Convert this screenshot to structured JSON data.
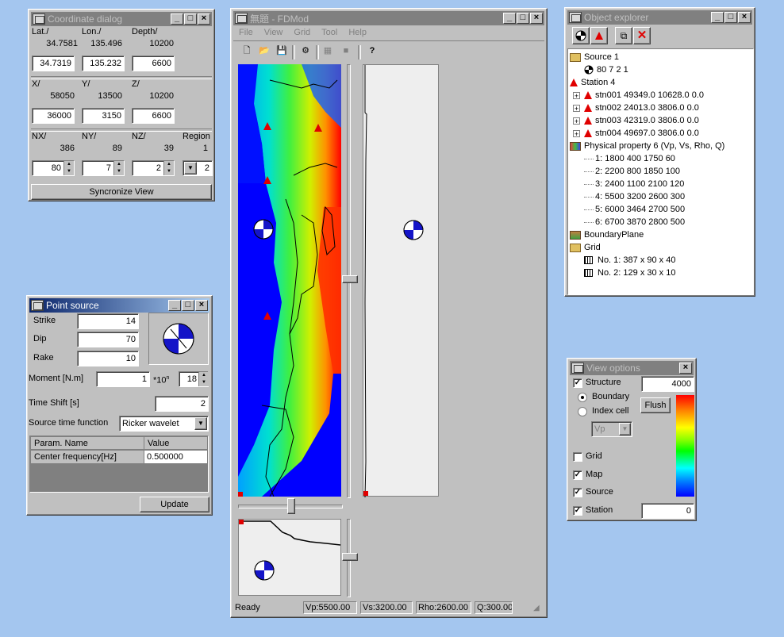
{
  "coord": {
    "title": "Coordinate dialog",
    "lat_label": "Lat./",
    "lon_label": "Lon./",
    "depth_label": "Depth/",
    "lat_value": "34.7581",
    "lon_value": "135.496",
    "depth_value": "10200",
    "lat_input": "34.7319",
    "lon_input": "135.232",
    "depth_input": "6600",
    "x_label": "X/",
    "y_label": "Y/",
    "z_label": "Z/",
    "x_value": "58050",
    "y_value": "13500",
    "z_value": "10200",
    "x_input": "36000",
    "y_input": "3150",
    "z_input": "6600",
    "nx_label": "NX/",
    "ny_label": "NY/",
    "nz_label": "NZ/",
    "region_label": "Region",
    "nx_value": "386",
    "ny_value": "89",
    "nz_value": "39",
    "region_value": "1",
    "nx_input": "80",
    "ny_input": "7",
    "nz_input": "2",
    "region_input": "2",
    "sync_button": "Syncronize View"
  },
  "point": {
    "title": "Point source",
    "strike_label": "Strike",
    "strike_value": "14",
    "dip_label": "Dip",
    "dip_value": "70",
    "rake_label": "Rake",
    "rake_value": "10",
    "moment_label": "Moment [N.m]",
    "moment_value": "1",
    "moment_x": "*10",
    "moment_sup": "n",
    "moment_exp": "18",
    "timeshift_label": "Time Shift [s]",
    "timeshift_value": "2",
    "stf_label": "Source time function",
    "stf_value": "Ricker wavelet",
    "col_name": "Param. Name",
    "col_value": "Value",
    "row_name": "Center frequency[Hz]",
    "row_value": "0.500000",
    "update_button": "Update"
  },
  "main": {
    "title": "無題 - FDMod",
    "menu": [
      "File",
      "View",
      "Grid",
      "Tool",
      "Help"
    ],
    "status": {
      "ready": "Ready",
      "vp": "Vp:5500.00",
      "vs": "Vs:3200.00",
      "rho": "Rho:2600.00",
      "q": "Q:300.00"
    }
  },
  "explorer": {
    "title": "Object explorer",
    "rows": [
      {
        "text": "Source 1",
        "indent": 0,
        "icon": "source-folder"
      },
      {
        "text": "80 7 2 1",
        "indent": 1,
        "icon": "beachball"
      },
      {
        "text": "Station 4",
        "indent": 0,
        "icon": "station-folder"
      },
      {
        "text": "stn001 49349.0 10628.0 0.0",
        "indent": 1,
        "icon": "station",
        "plus": true
      },
      {
        "text": "stn002 24013.0 3806.0 0.0",
        "indent": 1,
        "icon": "station",
        "plus": true
      },
      {
        "text": "stn003 42319.0 3806.0 0.0",
        "indent": 1,
        "icon": "station",
        "plus": true
      },
      {
        "text": "stn004 49697.0 3806.0 0.0",
        "indent": 1,
        "icon": "station",
        "plus": true
      },
      {
        "text": "Physical property 6 (Vp, Vs, Rho, Q)",
        "indent": 0,
        "icon": "property-folder"
      },
      {
        "text": "1:  1800 400 1750 60",
        "indent": 1,
        "icon": "none"
      },
      {
        "text": "2:  2200 800 1850 100",
        "indent": 1,
        "icon": "none"
      },
      {
        "text": "3:  2400 1100 2100 120",
        "indent": 1,
        "icon": "none"
      },
      {
        "text": "4:  5500 3200 2600 300",
        "indent": 1,
        "icon": "none"
      },
      {
        "text": "5:  6000 3464 2700 500",
        "indent": 1,
        "icon": "none"
      },
      {
        "text": "6:  6700 3870 2800 500",
        "indent": 1,
        "icon": "none"
      },
      {
        "text": "BoundaryPlane",
        "indent": 0,
        "icon": "boundary-folder"
      },
      {
        "text": "Grid",
        "indent": 0,
        "icon": "grid-folder"
      },
      {
        "text": "No. 1: 387 x 90 x 40",
        "indent": 1,
        "icon": "grid"
      },
      {
        "text": "No. 2: 129 x 30 x 10",
        "indent": 1,
        "icon": "grid"
      }
    ]
  },
  "view": {
    "title": "View options",
    "structure_label": "Structure",
    "structure_value": "4000",
    "boundary_label": "Boundary",
    "index_label": "Index cell",
    "flush_button": "Flush",
    "vp_select": "Vp",
    "grid_label": "Grid",
    "map_label": "Map",
    "source_label": "Source",
    "station_label": "Station",
    "station_value": "0"
  }
}
